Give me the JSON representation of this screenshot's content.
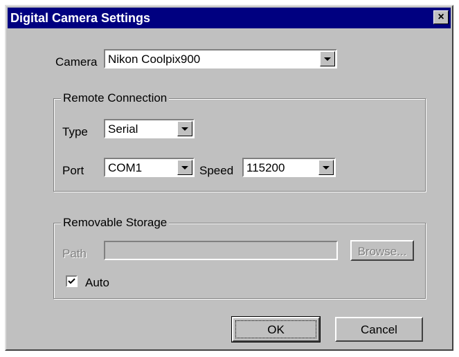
{
  "window": {
    "title": "Digital Camera Settings",
    "close_glyph": "×"
  },
  "camera": {
    "label": "Camera",
    "selected": "Nikon Coolpix900"
  },
  "remote_connection": {
    "legend": "Remote Connection",
    "type_label": "Type",
    "type_value": "Serial",
    "port_label": "Port",
    "port_value": "COM1",
    "speed_label": "Speed",
    "speed_value": "115200"
  },
  "removable_storage": {
    "legend": "Removable Storage",
    "path_label": "Path",
    "path_value": "",
    "browse_label": "Browse...",
    "auto_label": "Auto",
    "auto_checked": true
  },
  "buttons": {
    "ok_label": "OK",
    "cancel_label": "Cancel"
  },
  "colors": {
    "face": "#c0c0c0",
    "titlebar": "#000080",
    "disabled_text": "#808080"
  }
}
